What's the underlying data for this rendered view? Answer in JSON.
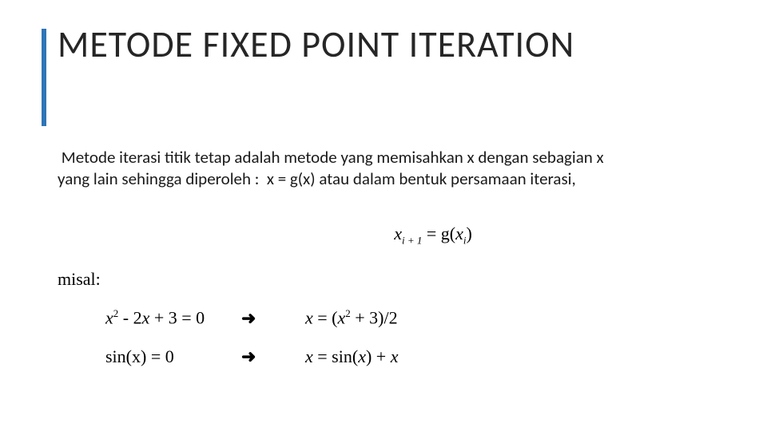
{
  "title": "METODE FIXED POINT ITERATION",
  "paragraph": " Metode iterasi titik tetap adalah metode yang memisahkan x dengan sebagian x yang lain sehingga diperoleh :  x = g(x) atau dalam bentuk persamaan iterasi,",
  "eq_main": {
    "var": "x",
    "sub_left": "i + 1",
    "equals": " = g(",
    "var2": "x",
    "sub_right": "i",
    "close": ")"
  },
  "misal_label": "misal:",
  "examples": [
    {
      "lhs_a": "x",
      "lhs_sup": "2",
      "lhs_b": " - 2",
      "lhs_c": "x",
      "lhs_d": " + 3 = 0",
      "arrow": "➜",
      "rhs_a": "x",
      "rhs_b": " = (",
      "rhs_c": "x",
      "rhs_sup": "2",
      "rhs_d": " + 3)/2"
    },
    {
      "lhs_full": "sin(x) = 0",
      "arrow": "➜",
      "rhs_a": "x",
      "rhs_b": " = sin(",
      "rhs_c": "x",
      "rhs_d": ") + ",
      "rhs_e": "x"
    }
  ]
}
